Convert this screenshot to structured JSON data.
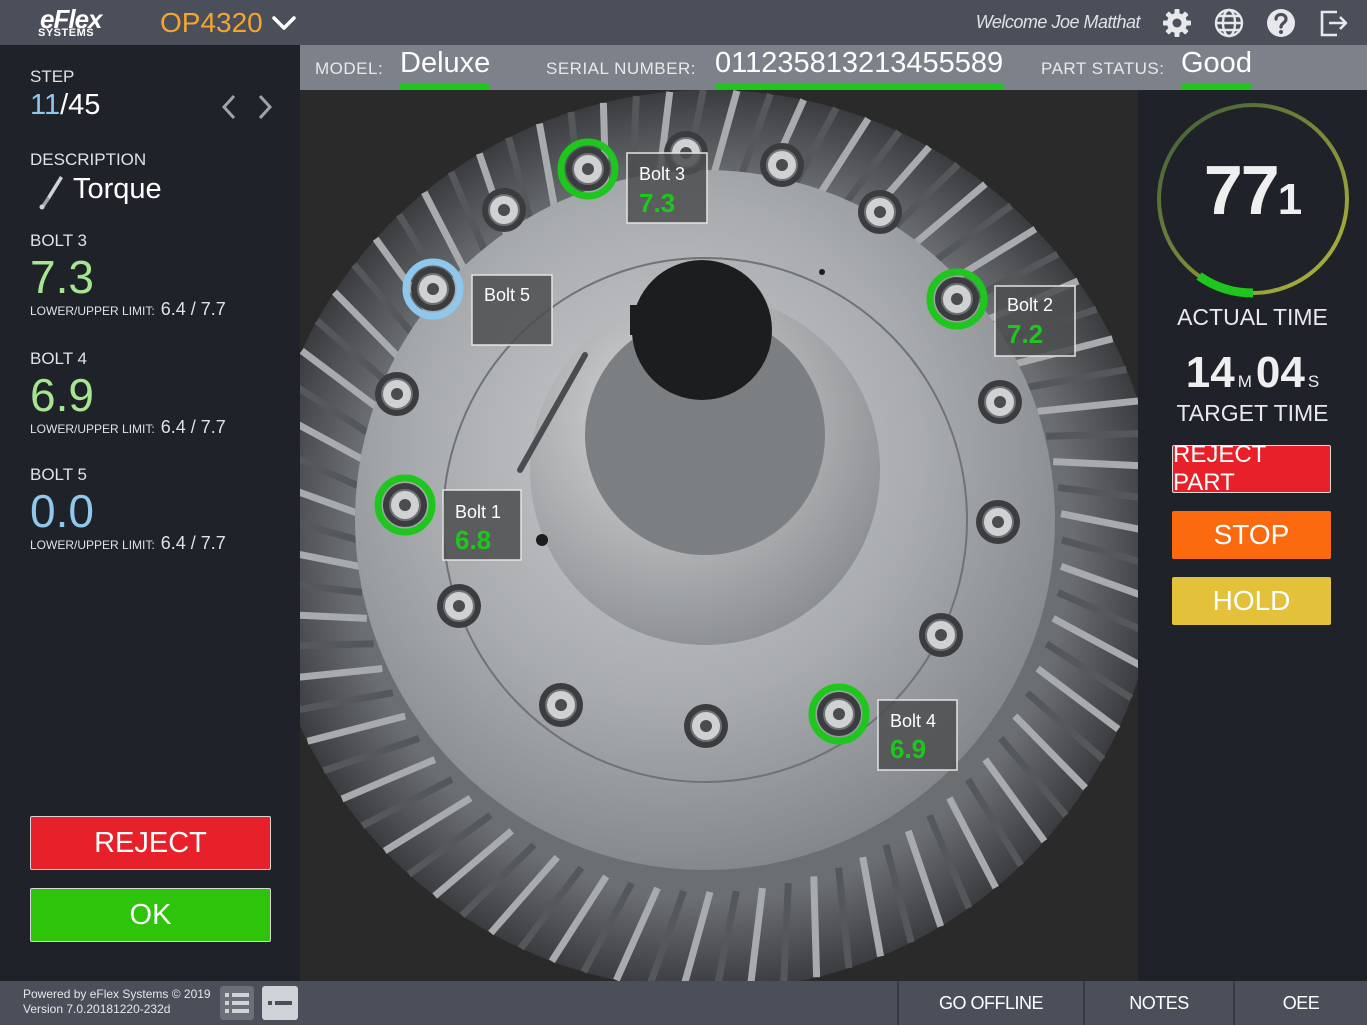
{
  "header": {
    "logo_top": "eFlex",
    "logo_bottom": "SYSTEMS",
    "operation": "OP4320",
    "welcome": "Welcome Joe Matthat",
    "icons": [
      "gear-icon",
      "globe-icon",
      "help-icon",
      "logout-icon"
    ]
  },
  "infobar": {
    "model_label": "MODEL:",
    "model_value": "Deluxe",
    "serial_label": "SERIAL NUMBER:",
    "serial_value": "011235813213455589",
    "status_label": "PART STATUS:",
    "status_value": "Good"
  },
  "left": {
    "step_label": "STEP",
    "step_current": "11",
    "step_total": "/45",
    "description_label": "DESCRIPTION",
    "description_value": "Torque",
    "limit_label": "LOWER/UPPER LIMIT:",
    "bolts": [
      {
        "label": "BOLT 3",
        "value": "7.3",
        "limits": "6.4 / 7.7",
        "color": "#a5e68f"
      },
      {
        "label": "BOLT 4",
        "value": "6.9",
        "limits": "6.4 / 7.7",
        "color": "#a5e68f"
      },
      {
        "label": "BOLT 5",
        "value": "0.0",
        "limits": "6.4 / 7.7",
        "color": "#8fc8ec"
      }
    ],
    "reject_label": "REJECT",
    "ok_label": "OK"
  },
  "viewer": {
    "callouts": [
      {
        "name": "Bolt 3",
        "value": "7.3"
      },
      {
        "name": "Bolt 5",
        "value": ""
      },
      {
        "name": "Bolt 2",
        "value": "7.2"
      },
      {
        "name": "Bolt 1",
        "value": "6.8"
      },
      {
        "name": "Bolt 4",
        "value": "6.9"
      }
    ]
  },
  "right": {
    "actual_value_big": "77",
    "actual_value_small": "1",
    "actual_label": "ACTUAL TIME",
    "target_minutes": "14",
    "target_m_unit": "M",
    "target_seconds": "04",
    "target_s_unit": "S",
    "target_label": "TARGET TIME",
    "reject_part_label": "REJECT PART",
    "stop_label": "STOP",
    "hold_label": "HOLD",
    "colors": {
      "reject": "#e8202a",
      "stop": "#fb6a0e",
      "hold": "#e4c13a",
      "ok": "#2ec40c"
    }
  },
  "footer": {
    "powered": "Powered by eFlex Systems © 2019",
    "version": "Version 7.0.20181220-232d",
    "go_offline": "GO OFFLINE",
    "notes": "NOTES",
    "oee": "OEE"
  }
}
